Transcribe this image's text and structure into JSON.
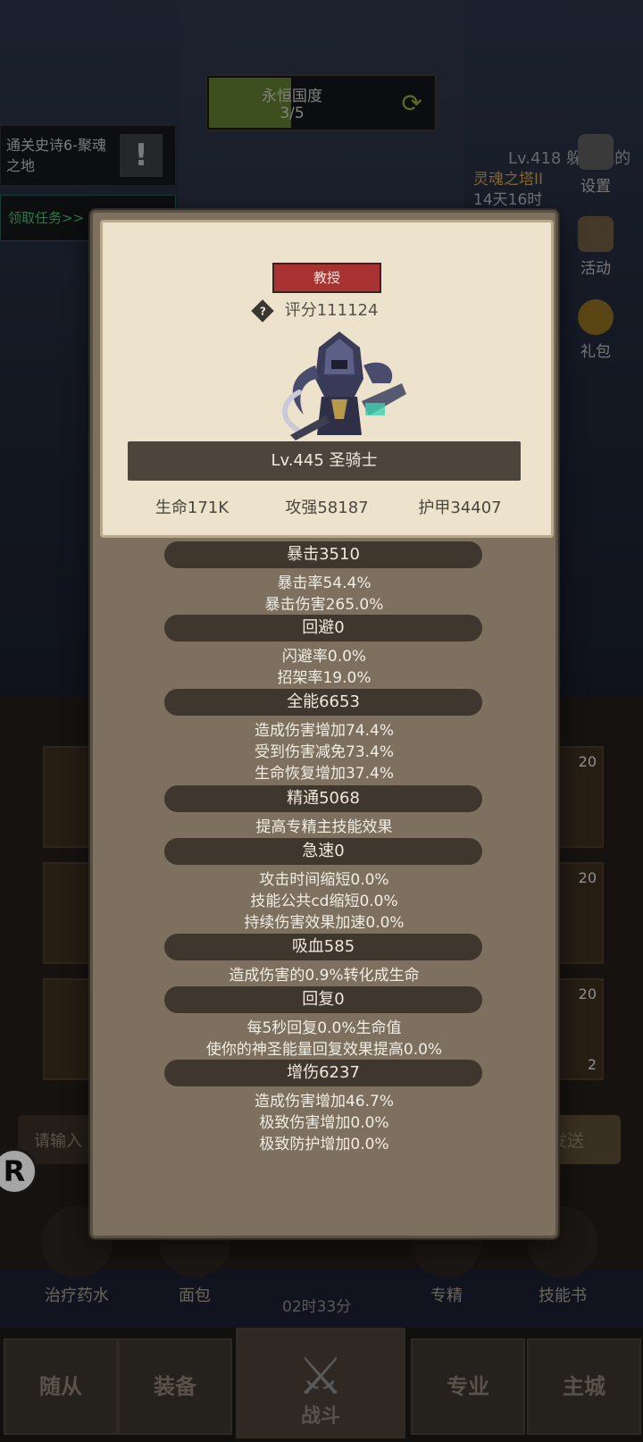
{
  "background": {
    "progress": {
      "title": "永恒国度",
      "count": "3/5",
      "fraction": 0.6
    },
    "quest": {
      "text": "通关史诗6-聚魂之地",
      "badge": "!"
    },
    "claim": "领取任务>>",
    "player_tag": "Lv.418 躲不掉的",
    "tower_name": "灵魂之塔II",
    "tower_time": "14天16时",
    "side_buttons": [
      {
        "label": "设置"
      },
      {
        "label": "活动"
      },
      {
        "label": "礼包"
      }
    ],
    "slot_counts": [
      "20",
      "20",
      "20",
      "2"
    ],
    "input_placeholder": "请输入",
    "send_label": "发送",
    "quick_items": [
      {
        "label": "治疗药水"
      },
      {
        "label": "面包"
      },
      {
        "label": "专精"
      },
      {
        "label": "技能书"
      }
    ],
    "timer": "02时33分"
  },
  "nav": {
    "tabs": [
      "随从",
      "装备",
      "战斗",
      "专业",
      "主城"
    ]
  },
  "hero": {
    "title": "教授",
    "score": "评分111124",
    "level_name": "Lv.445 圣骑士",
    "hp": "生命171K",
    "attack": "攻强58187",
    "armor": "护甲34407"
  },
  "stats": [
    {
      "name": "暴击3510",
      "lines": [
        "暴击率54.4%",
        "暴击伤害265.0%"
      ]
    },
    {
      "name": "回避0",
      "lines": [
        "闪避率0.0%",
        "招架率19.0%"
      ]
    },
    {
      "name": "全能6653",
      "lines": [
        "造成伤害增加74.4%",
        "受到伤害减免73.4%",
        "生命恢复增加37.4%"
      ]
    },
    {
      "name": "精通5068",
      "lines": [
        "提高专精主技能效果"
      ]
    },
    {
      "name": "急速0",
      "lines": [
        "攻击时间缩短0.0%",
        "技能公共cd缩短0.0%",
        "持续伤害效果加速0.0%"
      ]
    },
    {
      "name": "吸血585",
      "lines": [
        "造成伤害的0.9%转化成生命"
      ]
    },
    {
      "name": "回复0",
      "lines": [
        "每5秒回复0.0%生命值",
        "使你的神圣能量回复效果提高0.0%"
      ]
    },
    {
      "name": "增伤6237",
      "lines": [
        "造成伤害增加46.7%",
        "极致伤害增加0.0%",
        "极致防护增加0.0%"
      ]
    }
  ]
}
